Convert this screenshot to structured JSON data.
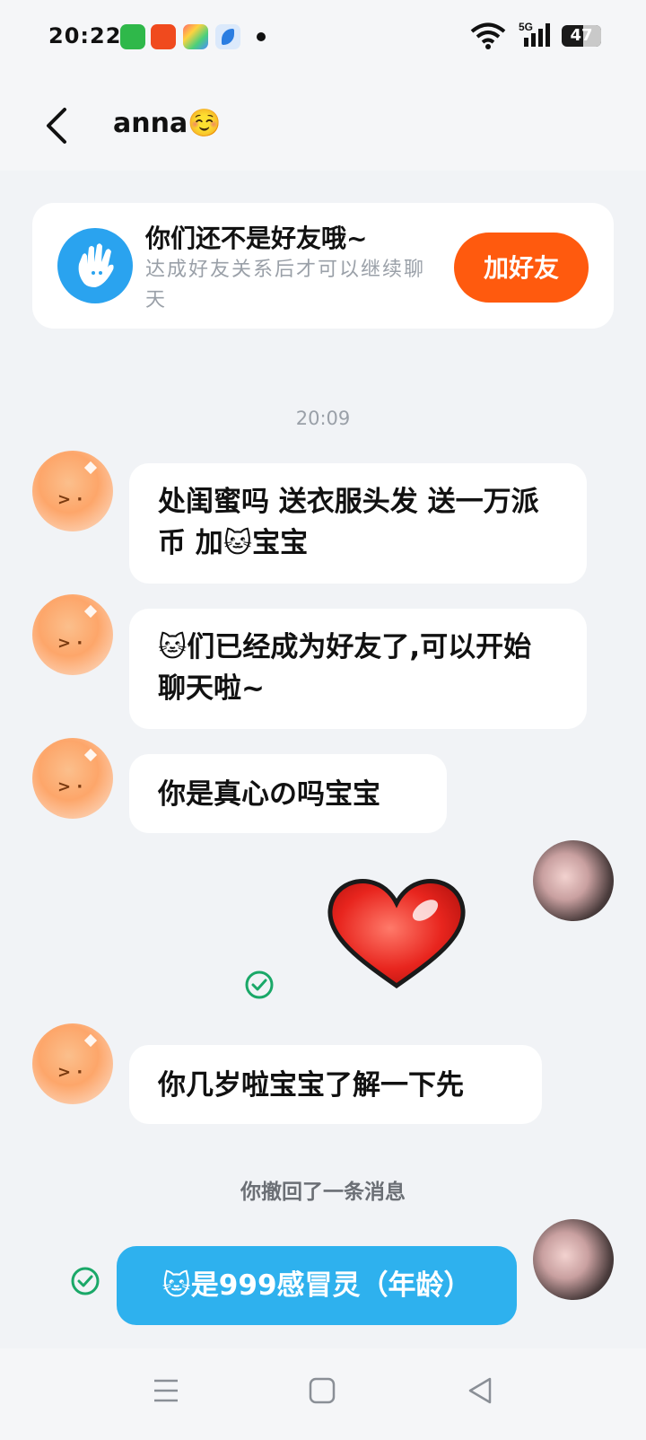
{
  "status_bar": {
    "time": "20:22",
    "network": "5G",
    "battery": "47",
    "app_icons": [
      {
        "name": "shopping-app-icon",
        "color": "#2fb84a"
      },
      {
        "name": "pinduoduo-app-icon",
        "color": "#f04a1e"
      },
      {
        "name": "colorful-app-icon",
        "color": "#e9e4f2"
      },
      {
        "name": "blue-feather-app-icon",
        "color": "#dbe9fb"
      }
    ]
  },
  "header": {
    "title": "anna☺️"
  },
  "friend_banner": {
    "title": "你们还不是好友哦~",
    "subtitle": "达成好友关系后才可以继续聊天",
    "button": "加好友",
    "icon": "waving-hand-icon",
    "accent": "#ff5a0e"
  },
  "chat": {
    "timestamp": "20:09",
    "messages": [
      {
        "from": "them",
        "text": "处闺蜜吗 送衣服头发 送⼀万派币 加🐱宝宝"
      },
      {
        "from": "them",
        "text": "🐱们已经成为好友了,可以开始聊天啦~"
      },
      {
        "from": "them",
        "text": "你是真心の吗宝宝"
      },
      {
        "from": "me",
        "sticker": "red-heart-sticker"
      },
      {
        "from": "them",
        "text": "你几岁啦宝宝了解⼀下先"
      },
      {
        "from": "me",
        "text": "🐱是999感冒灵（年龄）"
      }
    ],
    "recall_notice": "你撤回了⼀条消息",
    "sent_bubble_color": "#2eb1ee"
  },
  "nav_bar": {
    "icons": [
      "menu-icon",
      "home-square-icon",
      "back-triangle-icon"
    ]
  }
}
